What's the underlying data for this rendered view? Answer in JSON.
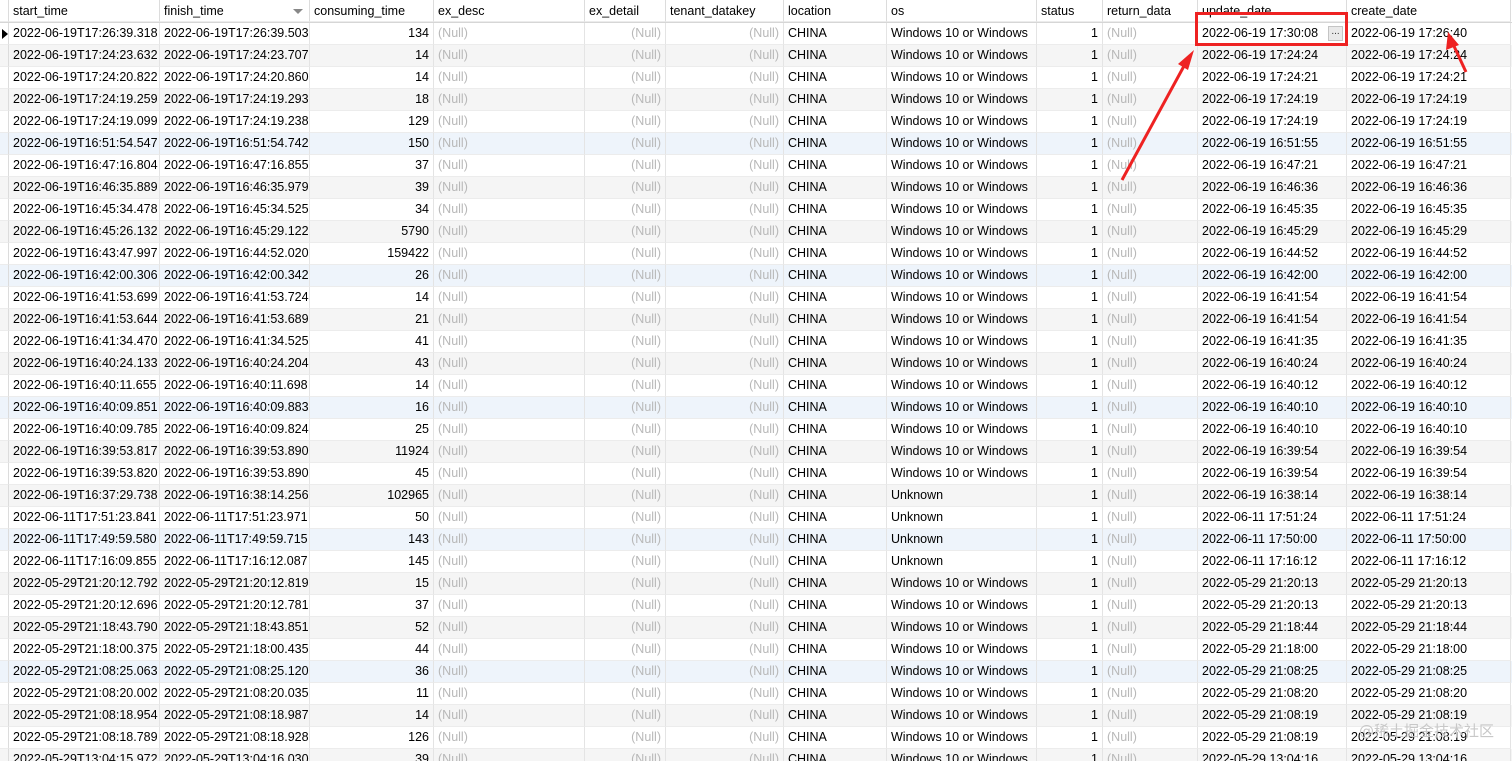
{
  "columns": [
    "start_time",
    "finish_time",
    "consuming_time",
    "ex_desc",
    "ex_detail",
    "tenant_datakey",
    "location",
    "os",
    "status",
    "return_data",
    "update_date",
    "create_date"
  ],
  "null_text": "(Null)",
  "ellipsis": "...",
  "annotation_color": "#ee2222",
  "watermark": "@稀土掘金技术社区",
  "rows": [
    {
      "start_time": "2022-06-19T17:26:39.318",
      "finish_time": "2022-06-19T17:26:39.503",
      "consuming_time": "134",
      "location": "CHINA",
      "os": "Windows 10 or Windows",
      "status": "1",
      "update_date": "2022-06-19 17:30:08",
      "create_date": "2022-06-19 17:26:40"
    },
    {
      "start_time": "2022-06-19T17:24:23.632",
      "finish_time": "2022-06-19T17:24:23.707",
      "consuming_time": "14",
      "location": "CHINA",
      "os": "Windows 10 or Windows",
      "status": "1",
      "update_date": "2022-06-19 17:24:24",
      "create_date": "2022-06-19 17:24:24"
    },
    {
      "start_time": "2022-06-19T17:24:20.822",
      "finish_time": "2022-06-19T17:24:20.860",
      "consuming_time": "14",
      "location": "CHINA",
      "os": "Windows 10 or Windows",
      "status": "1",
      "update_date": "2022-06-19 17:24:21",
      "create_date": "2022-06-19 17:24:21"
    },
    {
      "start_time": "2022-06-19T17:24:19.259",
      "finish_time": "2022-06-19T17:24:19.293",
      "consuming_time": "18",
      "location": "CHINA",
      "os": "Windows 10 or Windows",
      "status": "1",
      "update_date": "2022-06-19 17:24:19",
      "create_date": "2022-06-19 17:24:19"
    },
    {
      "start_time": "2022-06-19T17:24:19.099",
      "finish_time": "2022-06-19T17:24:19.238",
      "consuming_time": "129",
      "location": "CHINA",
      "os": "Windows 10 or Windows",
      "status": "1",
      "update_date": "2022-06-19 17:24:19",
      "create_date": "2022-06-19 17:24:19"
    },
    {
      "start_time": "2022-06-19T16:51:54.547",
      "finish_time": "2022-06-19T16:51:54.742",
      "consuming_time": "150",
      "location": "CHINA",
      "os": "Windows 10 or Windows",
      "status": "1",
      "update_date": "2022-06-19 16:51:55",
      "create_date": "2022-06-19 16:51:55"
    },
    {
      "start_time": "2022-06-19T16:47:16.804",
      "finish_time": "2022-06-19T16:47:16.855",
      "consuming_time": "37",
      "location": "CHINA",
      "os": "Windows 10 or Windows",
      "status": "1",
      "update_date": "2022-06-19 16:47:21",
      "create_date": "2022-06-19 16:47:21"
    },
    {
      "start_time": "2022-06-19T16:46:35.889",
      "finish_time": "2022-06-19T16:46:35.979",
      "consuming_time": "39",
      "location": "CHINA",
      "os": "Windows 10 or Windows",
      "status": "1",
      "update_date": "2022-06-19 16:46:36",
      "create_date": "2022-06-19 16:46:36"
    },
    {
      "start_time": "2022-06-19T16:45:34.478",
      "finish_time": "2022-06-19T16:45:34.525",
      "consuming_time": "34",
      "location": "CHINA",
      "os": "Windows 10 or Windows",
      "status": "1",
      "update_date": "2022-06-19 16:45:35",
      "create_date": "2022-06-19 16:45:35"
    },
    {
      "start_time": "2022-06-19T16:45:26.132",
      "finish_time": "2022-06-19T16:45:29.122",
      "consuming_time": "5790",
      "location": "CHINA",
      "os": "Windows 10 or Windows",
      "status": "1",
      "update_date": "2022-06-19 16:45:29",
      "create_date": "2022-06-19 16:45:29"
    },
    {
      "start_time": "2022-06-19T16:43:47.997",
      "finish_time": "2022-06-19T16:44:52.020",
      "consuming_time": "159422",
      "location": "CHINA",
      "os": "Windows 10 or Windows",
      "status": "1",
      "update_date": "2022-06-19 16:44:52",
      "create_date": "2022-06-19 16:44:52"
    },
    {
      "start_time": "2022-06-19T16:42:00.306",
      "finish_time": "2022-06-19T16:42:00.342",
      "consuming_time": "26",
      "location": "CHINA",
      "os": "Windows 10 or Windows",
      "status": "1",
      "update_date": "2022-06-19 16:42:00",
      "create_date": "2022-06-19 16:42:00"
    },
    {
      "start_time": "2022-06-19T16:41:53.699",
      "finish_time": "2022-06-19T16:41:53.724",
      "consuming_time": "14",
      "location": "CHINA",
      "os": "Windows 10 or Windows",
      "status": "1",
      "update_date": "2022-06-19 16:41:54",
      "create_date": "2022-06-19 16:41:54"
    },
    {
      "start_time": "2022-06-19T16:41:53.644",
      "finish_time": "2022-06-19T16:41:53.689",
      "consuming_time": "21",
      "location": "CHINA",
      "os": "Windows 10 or Windows",
      "status": "1",
      "update_date": "2022-06-19 16:41:54",
      "create_date": "2022-06-19 16:41:54"
    },
    {
      "start_time": "2022-06-19T16:41:34.470",
      "finish_time": "2022-06-19T16:41:34.525",
      "consuming_time": "41",
      "location": "CHINA",
      "os": "Windows 10 or Windows",
      "status": "1",
      "update_date": "2022-06-19 16:41:35",
      "create_date": "2022-06-19 16:41:35"
    },
    {
      "start_time": "2022-06-19T16:40:24.133",
      "finish_time": "2022-06-19T16:40:24.204",
      "consuming_time": "43",
      "location": "CHINA",
      "os": "Windows 10 or Windows",
      "status": "1",
      "update_date": "2022-06-19 16:40:24",
      "create_date": "2022-06-19 16:40:24"
    },
    {
      "start_time": "2022-06-19T16:40:11.655",
      "finish_time": "2022-06-19T16:40:11.698",
      "consuming_time": "14",
      "location": "CHINA",
      "os": "Windows 10 or Windows",
      "status": "1",
      "update_date": "2022-06-19 16:40:12",
      "create_date": "2022-06-19 16:40:12"
    },
    {
      "start_time": "2022-06-19T16:40:09.851",
      "finish_time": "2022-06-19T16:40:09.883",
      "consuming_time": "16",
      "location": "CHINA",
      "os": "Windows 10 or Windows",
      "status": "1",
      "update_date": "2022-06-19 16:40:10",
      "create_date": "2022-06-19 16:40:10"
    },
    {
      "start_time": "2022-06-19T16:40:09.785",
      "finish_time": "2022-06-19T16:40:09.824",
      "consuming_time": "25",
      "location": "CHINA",
      "os": "Windows 10 or Windows",
      "status": "1",
      "update_date": "2022-06-19 16:40:10",
      "create_date": "2022-06-19 16:40:10"
    },
    {
      "start_time": "2022-06-19T16:39:53.817",
      "finish_time": "2022-06-19T16:39:53.890",
      "consuming_time": "11924",
      "location": "CHINA",
      "os": "Windows 10 or Windows",
      "status": "1",
      "update_date": "2022-06-19 16:39:54",
      "create_date": "2022-06-19 16:39:54"
    },
    {
      "start_time": "2022-06-19T16:39:53.820",
      "finish_time": "2022-06-19T16:39:53.890",
      "consuming_time": "45",
      "location": "CHINA",
      "os": "Windows 10 or Windows",
      "status": "1",
      "update_date": "2022-06-19 16:39:54",
      "create_date": "2022-06-19 16:39:54"
    },
    {
      "start_time": "2022-06-19T16:37:29.738",
      "finish_time": "2022-06-19T16:38:14.256",
      "consuming_time": "102965",
      "location": "CHINA",
      "os": "Unknown",
      "status": "1",
      "update_date": "2022-06-19 16:38:14",
      "create_date": "2022-06-19 16:38:14"
    },
    {
      "start_time": "2022-06-11T17:51:23.841",
      "finish_time": "2022-06-11T17:51:23.971",
      "consuming_time": "50",
      "location": "CHINA",
      "os": "Unknown",
      "status": "1",
      "update_date": "2022-06-11 17:51:24",
      "create_date": "2022-06-11 17:51:24"
    },
    {
      "start_time": "2022-06-11T17:49:59.580",
      "finish_time": "2022-06-11T17:49:59.715",
      "consuming_time": "143",
      "location": "CHINA",
      "os": "Unknown",
      "status": "1",
      "update_date": "2022-06-11 17:50:00",
      "create_date": "2022-06-11 17:50:00"
    },
    {
      "start_time": "2022-06-11T17:16:09.855",
      "finish_time": "2022-06-11T17:16:12.087",
      "consuming_time": "145",
      "location": "CHINA",
      "os": "Unknown",
      "status": "1",
      "update_date": "2022-06-11 17:16:12",
      "create_date": "2022-06-11 17:16:12"
    },
    {
      "start_time": "2022-05-29T21:20:12.792",
      "finish_time": "2022-05-29T21:20:12.819",
      "consuming_time": "15",
      "location": "CHINA",
      "os": "Windows 10 or Windows",
      "status": "1",
      "update_date": "2022-05-29 21:20:13",
      "create_date": "2022-05-29 21:20:13"
    },
    {
      "start_time": "2022-05-29T21:20:12.696",
      "finish_time": "2022-05-29T21:20:12.781",
      "consuming_time": "37",
      "location": "CHINA",
      "os": "Windows 10 or Windows",
      "status": "1",
      "update_date": "2022-05-29 21:20:13",
      "create_date": "2022-05-29 21:20:13"
    },
    {
      "start_time": "2022-05-29T21:18:43.790",
      "finish_time": "2022-05-29T21:18:43.851",
      "consuming_time": "52",
      "location": "CHINA",
      "os": "Windows 10 or Windows",
      "status": "1",
      "update_date": "2022-05-29 21:18:44",
      "create_date": "2022-05-29 21:18:44"
    },
    {
      "start_time": "2022-05-29T21:18:00.375",
      "finish_time": "2022-05-29T21:18:00.435",
      "consuming_time": "44",
      "location": "CHINA",
      "os": "Windows 10 or Windows",
      "status": "1",
      "update_date": "2022-05-29 21:18:00",
      "create_date": "2022-05-29 21:18:00"
    },
    {
      "start_time": "2022-05-29T21:08:25.063",
      "finish_time": "2022-05-29T21:08:25.120",
      "consuming_time": "36",
      "location": "CHINA",
      "os": "Windows 10 or Windows",
      "status": "1",
      "update_date": "2022-05-29 21:08:25",
      "create_date": "2022-05-29 21:08:25"
    },
    {
      "start_time": "2022-05-29T21:08:20.002",
      "finish_time": "2022-05-29T21:08:20.035",
      "consuming_time": "11",
      "location": "CHINA",
      "os": "Windows 10 or Windows",
      "status": "1",
      "update_date": "2022-05-29 21:08:20",
      "create_date": "2022-05-29 21:08:20"
    },
    {
      "start_time": "2022-05-29T21:08:18.954",
      "finish_time": "2022-05-29T21:08:18.987",
      "consuming_time": "14",
      "location": "CHINA",
      "os": "Windows 10 or Windows",
      "status": "1",
      "update_date": "2022-05-29 21:08:19",
      "create_date": "2022-05-29 21:08:19"
    },
    {
      "start_time": "2022-05-29T21:08:18.789",
      "finish_time": "2022-05-29T21:08:18.928",
      "consuming_time": "126",
      "location": "CHINA",
      "os": "Windows 10 or Windows",
      "status": "1",
      "update_date": "2022-05-29 21:08:19",
      "create_date": "2022-05-29 21:08:19"
    },
    {
      "start_time": "2022-05-29T13:04:15.972",
      "finish_time": "2022-05-29T13:04:16.030",
      "consuming_time": "39",
      "location": "CHINA",
      "os": "Windows 10 or Windows",
      "status": "1",
      "update_date": "2022-05-29 13:04:16",
      "create_date": "2022-05-29 13:04:16"
    }
  ]
}
